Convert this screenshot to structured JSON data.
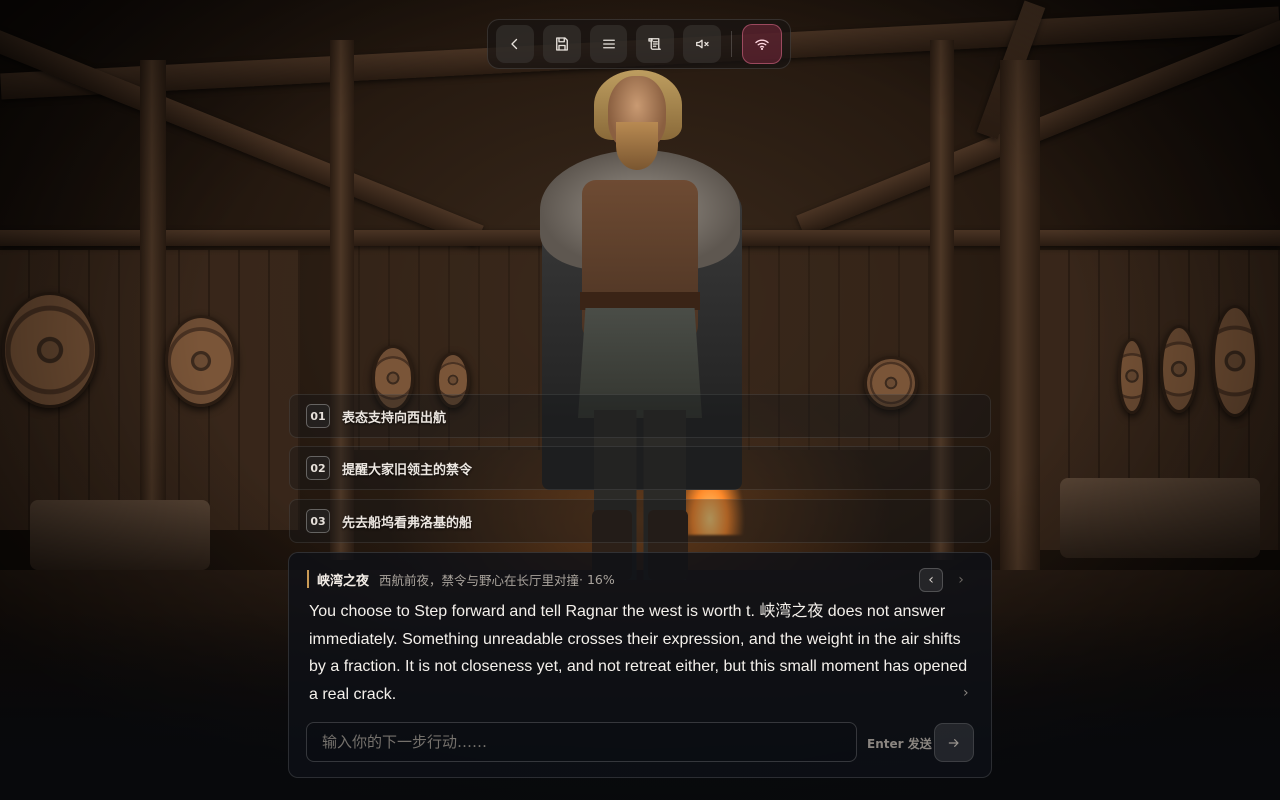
{
  "toolbar": {
    "buttons": [
      {
        "icon": "back-icon"
      },
      {
        "icon": "save-icon"
      },
      {
        "icon": "menu-icon"
      },
      {
        "icon": "scroll-icon"
      },
      {
        "icon": "mute-icon"
      }
    ],
    "network_icon": "wifi-icon",
    "accent": "#c0566e"
  },
  "choices": [
    {
      "num": "01",
      "text": "表态支持向西出航"
    },
    {
      "num": "02",
      "text": "提醒大家旧领主的禁令"
    },
    {
      "num": "03",
      "text": "先去船坞看弗洛基的船"
    }
  ],
  "dialogue": {
    "speaker": "峡湾之夜",
    "subtitle": "西航前夜，禁令与野心在长厅里对撞",
    "progress": "· 16%",
    "prev_label": "‹",
    "next_label": "›",
    "more_label": "›",
    "text": "You choose to Step forward and tell Ragnar the west is worth t. 峡湾之夜 does not answer immediately. Something unreadable crosses their expression, and the weight in the air shifts by a fraction. It is not closeness yet, and not retreat either, but this small moment has opened a real crack.",
    "input_placeholder": "输入你的下一步行动……",
    "send_hint": "Enter 发送",
    "send_icon": "arrow-right-icon"
  }
}
